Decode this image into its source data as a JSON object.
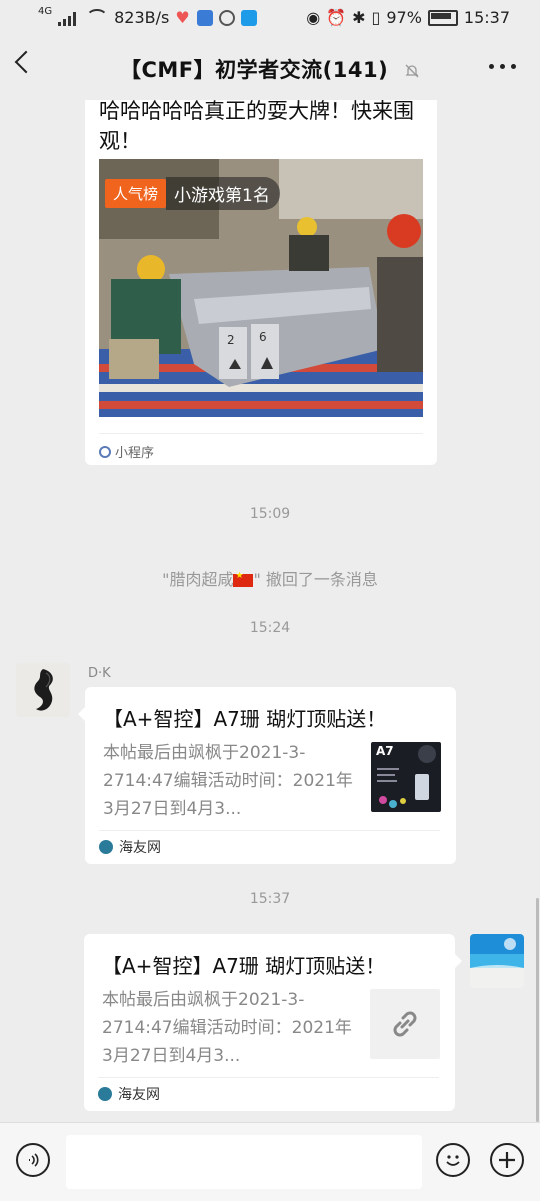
{
  "status": {
    "network": "4G",
    "speed": "823B/s",
    "battery": "97%",
    "time": "15:37"
  },
  "header": {
    "title": "【CMF】初学者交流(141)"
  },
  "mini_program": {
    "title": "哈哈哈哈哈真正的耍大牌！快来围观！",
    "badge_tag": "人气榜",
    "badge_text": "小游戏第1名",
    "source": "小程序"
  },
  "timestamps": [
    "15:09",
    "15:24",
    "15:37"
  ],
  "recall": {
    "prefix": "\"腊肉超咸",
    "suffix": "\" 撤回了一条消息"
  },
  "message1": {
    "sender": "D·K",
    "title": "【A+智控】A7珊 瑚灯顶贴送！",
    "desc": "本帖最后由飒枫于2021-3-2714:47编辑活动时间：2021年3月27日到4月3...",
    "source": "海友网",
    "thumb_label": "A7"
  },
  "message2": {
    "title": "【A+智控】A7珊 瑚灯顶贴送！",
    "desc": "本帖最后由飒枫于2021-3-2714:47编辑活动时间：2021年3月27日到4月3...",
    "source": "海友网"
  }
}
